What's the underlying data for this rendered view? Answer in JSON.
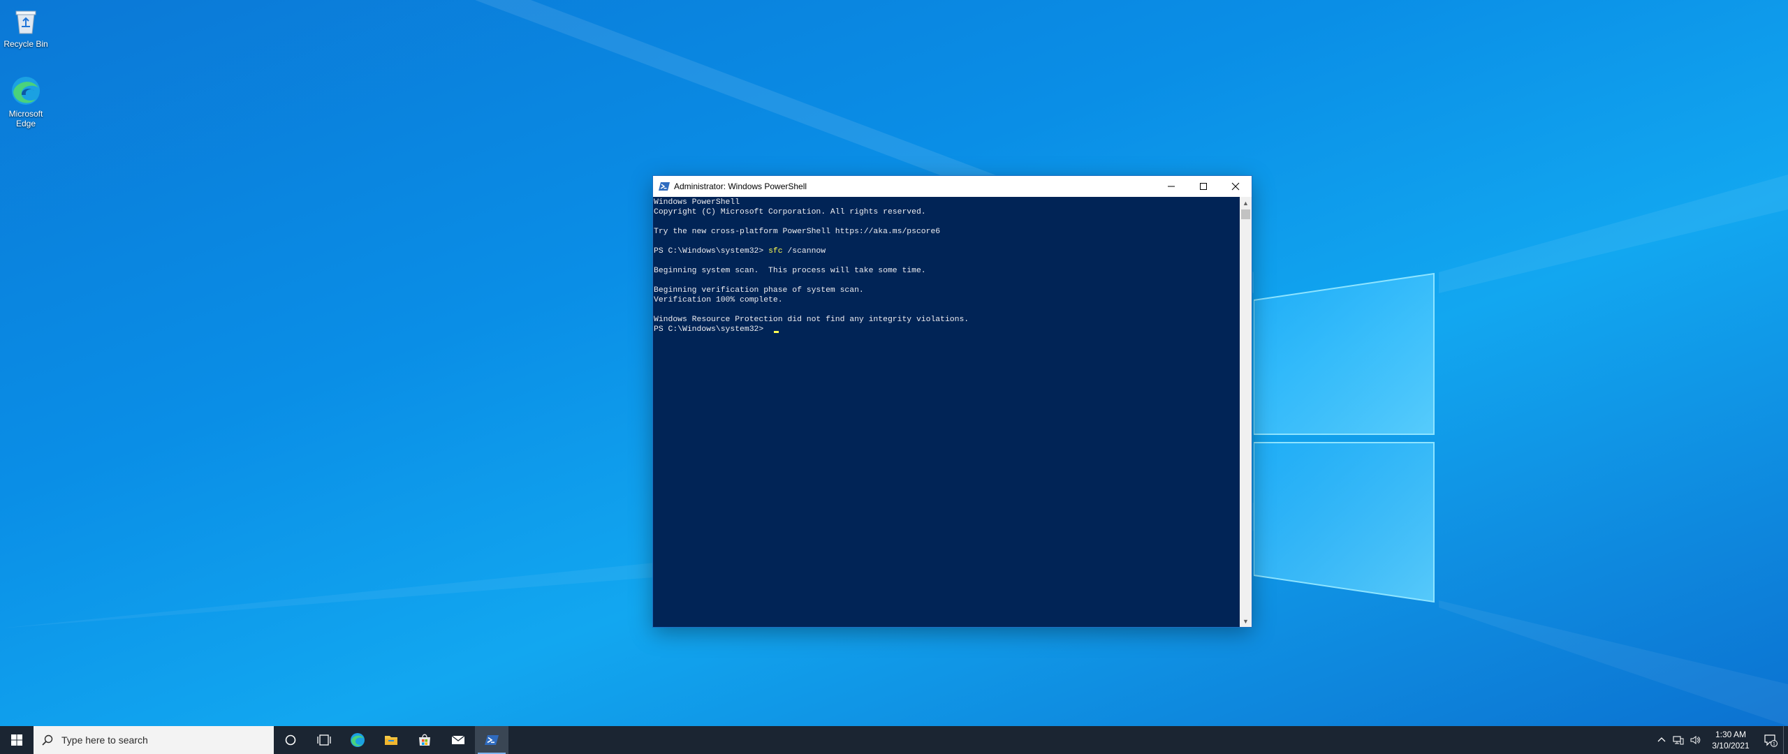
{
  "desktop": {
    "icons": [
      {
        "label": "Recycle Bin",
        "icon": "recycle-bin-icon"
      },
      {
        "label": "Microsoft Edge",
        "icon": "edge-icon"
      }
    ]
  },
  "window": {
    "title": "Administrator: Windows PowerShell",
    "icon": "powershell-icon",
    "lines": [
      {
        "text": "Windows PowerShell"
      },
      {
        "text": "Copyright (C) Microsoft Corporation. All rights reserved."
      },
      {
        "text": ""
      },
      {
        "text": "Try the new cross-platform PowerShell https://aka.ms/pscore6"
      },
      {
        "text": ""
      },
      {
        "prompt": "PS C:\\Windows\\system32> ",
        "command": "sfc",
        "args": " /scannow"
      },
      {
        "text": ""
      },
      {
        "text": "Beginning system scan.  This process will take some time."
      },
      {
        "text": ""
      },
      {
        "text": "Beginning verification phase of system scan."
      },
      {
        "text": "Verification 100% complete."
      },
      {
        "text": ""
      },
      {
        "text": "Windows Resource Protection did not find any integrity violations."
      },
      {
        "prompt": "PS C:\\Windows\\system32> ",
        "cursor": true
      }
    ],
    "colors": {
      "console_bg": "#012456",
      "command": "#fcfc52"
    }
  },
  "taskbar": {
    "search_placeholder": "Type here to search",
    "items": [
      "start-icon",
      "cortana-icon",
      "task-view-icon",
      "edge-icon",
      "file-explorer-icon",
      "store-icon",
      "mail-icon",
      "powershell-icon"
    ],
    "active_item": "powershell-icon",
    "tray": {
      "time": "1:30 AM",
      "date": "3/10/2021",
      "notification_count": "1"
    }
  }
}
